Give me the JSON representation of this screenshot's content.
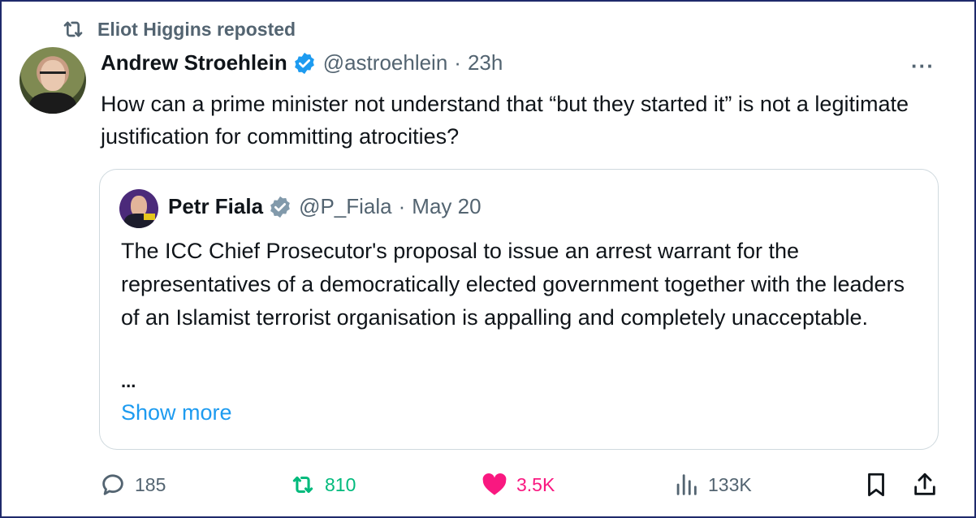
{
  "repost": {
    "text": "Eliot Higgins reposted"
  },
  "tweet": {
    "author_name": "Andrew Stroehlein",
    "handle": "@astroehlein",
    "separator": "·",
    "time": "23h",
    "more": "···",
    "text": "How can a prime minister not understand that “but they started it” is not a legitimate justification for committing atrocities?"
  },
  "quote": {
    "author_name": "Petr Fiala",
    "handle": "@P_Fiala",
    "separator": "·",
    "time": "May 20",
    "text": "The ICC Chief Prosecutor's proposal to issue an arrest warrant for the representatives of a democratically elected government together with the leaders of an Islamist terrorist organisation is appalling and completely unacceptable.",
    "ellipsis": "...",
    "show_more": "Show more"
  },
  "actions": {
    "replies": "185",
    "reposts": "810",
    "likes": "3.5K",
    "views": "133K"
  },
  "colors": {
    "verified_blue": "#1d9bf0",
    "verified_gray": "#829aab",
    "repost_green": "#00ba7c",
    "like_pink": "#f91880",
    "muted_text": "#536471",
    "link_blue": "#1d9bf0"
  },
  "icons": {
    "repost": "repost-icon",
    "verified": "verified-badge-icon",
    "reply": "reply-icon",
    "like": "heart-icon",
    "views": "views-icon",
    "bookmark": "bookmark-icon",
    "share": "share-icon"
  }
}
